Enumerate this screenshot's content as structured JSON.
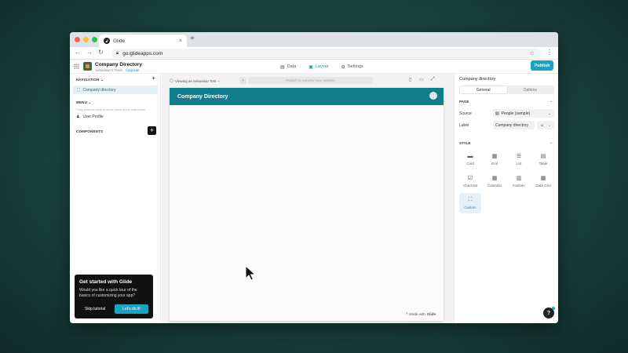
{
  "browser": {
    "tab_title": "Glide",
    "tab_close": "×",
    "new_tab": "+",
    "url": "go.glideapps.com",
    "traffic_colors": [
      "#ff5f57",
      "#febc2e",
      "#28c840"
    ]
  },
  "app": {
    "name": "Company Directory",
    "team": "Sebastian's Team",
    "team_separator": " · ",
    "upgrade": "Upgrade",
    "brand_color": "#0f7d8c",
    "accent_color": "#1ba3c6"
  },
  "header": {
    "tabs": [
      {
        "label": "Data",
        "icon": "database-icon",
        "glyph": "▤"
      },
      {
        "label": "Layout",
        "icon": "layout-icon",
        "glyph": "▣"
      },
      {
        "label": "Settings",
        "icon": "gear-icon",
        "glyph": "⚙"
      }
    ],
    "publish": "Publish"
  },
  "left": {
    "navigation_heading": "NAVIGATION",
    "nav_items": [
      {
        "label": "Company directory",
        "icon": "tab-icon"
      }
    ],
    "menu_heading": "MENU",
    "menu_hint": "Drag screens here to show them in the side menu",
    "menu_items": [
      {
        "label": "User Profile",
        "icon": "person-icon"
      }
    ],
    "components_heading": "COMPONENTS",
    "tour": {
      "title": "Get started with Glide",
      "description": "Would you like a quick tour of the basics of customizing your app?",
      "skip": "Skip tutorial",
      "go": "Let's do it!"
    }
  },
  "center": {
    "viewing_as": "Viewing as Sebastian Test",
    "publish_hint": "Publish to preview your website",
    "screen_title": "Company Directory",
    "made_with": "Made with",
    "made_brand": "Glide"
  },
  "right": {
    "title": "Company directory",
    "tabs": [
      "General",
      "Options"
    ],
    "page_heading": "PAGE",
    "source_label": "Source",
    "source_value": "People (sample)",
    "label_label": "Label",
    "label_value": "Company directory",
    "style_heading": "STYLE",
    "styles": [
      {
        "label": "Card",
        "glyph": "▬"
      },
      {
        "label": "Grid",
        "glyph": "▦"
      },
      {
        "label": "List",
        "glyph": "☰"
      },
      {
        "label": "Table",
        "glyph": "▤"
      },
      {
        "label": "Checklist",
        "glyph": "☑"
      },
      {
        "label": "Calendar",
        "glyph": "▦"
      },
      {
        "label": "Kanban",
        "glyph": "▥"
      },
      {
        "label": "Data Grid",
        "glyph": "▦"
      },
      {
        "label": "Custom",
        "glyph": "⛶"
      }
    ],
    "selected_style": "Custom",
    "help": "?"
  }
}
